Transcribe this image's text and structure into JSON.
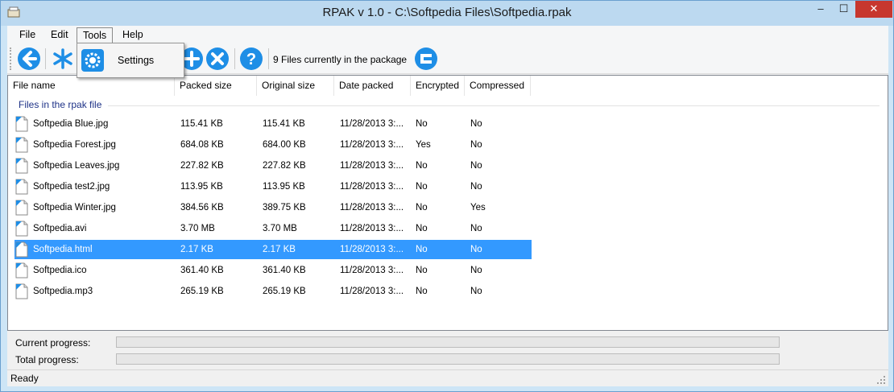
{
  "window": {
    "title": "RPAK v 1.0 - C:\\Softpedia Files\\Softpedia.rpak",
    "minimize_glyph": "‒",
    "maximize_glyph": "☐",
    "close_glyph": "✕"
  },
  "menu": {
    "items": [
      {
        "label": "File"
      },
      {
        "label": "Edit"
      },
      {
        "label": "Tools"
      },
      {
        "label": "Help"
      }
    ],
    "open_menu": "Tools",
    "dropdown": {
      "items": [
        {
          "label": "Settings",
          "icon": "gear-icon"
        }
      ]
    }
  },
  "toolbar": {
    "buttons": [
      {
        "name": "back-button",
        "icon": "arrow-left-icon"
      },
      {
        "name": "select-button",
        "icon": "asterisk-icon"
      },
      {
        "name": "settings-button",
        "icon": "gear-icon"
      },
      {
        "name": "add-button",
        "icon": "plus-icon"
      },
      {
        "name": "remove-button",
        "icon": "x-circle-icon"
      },
      {
        "name": "help-button",
        "icon": "question-icon"
      },
      {
        "name": "package-button",
        "icon": "package-icon"
      }
    ],
    "status": "9 Files currently in the package"
  },
  "list": {
    "columns": [
      "File name",
      "Packed size",
      "Original size",
      "Date packed",
      "Encrypted",
      "Compressed"
    ],
    "group_title": "Files in the rpak file",
    "rows": [
      {
        "name": "Softpedia Blue.jpg",
        "packed": "115.41 KB",
        "original": "115.41 KB",
        "date": "11/28/2013 3:...",
        "encrypted": "No",
        "compressed": "No"
      },
      {
        "name": "Softpedia Forest.jpg",
        "packed": "684.08 KB",
        "original": "684.00 KB",
        "date": "11/28/2013 3:...",
        "encrypted": "Yes",
        "compressed": "No"
      },
      {
        "name": "Softpedia Leaves.jpg",
        "packed": "227.82 KB",
        "original": "227.82 KB",
        "date": "11/28/2013 3:...",
        "encrypted": "No",
        "compressed": "No"
      },
      {
        "name": "Softpedia test2.jpg",
        "packed": "113.95 KB",
        "original": "113.95 KB",
        "date": "11/28/2013 3:...",
        "encrypted": "No",
        "compressed": "No"
      },
      {
        "name": "Softpedia Winter.jpg",
        "packed": "384.56 KB",
        "original": "389.75 KB",
        "date": "11/28/2013 3:...",
        "encrypted": "No",
        "compressed": "Yes"
      },
      {
        "name": "Softpedia.avi",
        "packed": "3.70 MB",
        "original": "3.70 MB",
        "date": "11/28/2013 3:...",
        "encrypted": "No",
        "compressed": "No"
      },
      {
        "name": "Softpedia.html",
        "packed": "2.17 KB",
        "original": "2.17 KB",
        "date": "11/28/2013 3:...",
        "encrypted": "No",
        "compressed": "No"
      },
      {
        "name": "Softpedia.ico",
        "packed": "361.40 KB",
        "original": "361.40 KB",
        "date": "11/28/2013 3:...",
        "encrypted": "No",
        "compressed": "No"
      },
      {
        "name": "Softpedia.mp3",
        "packed": "265.19 KB",
        "original": "265.19 KB",
        "date": "11/28/2013 3:...",
        "encrypted": "No",
        "compressed": "No"
      }
    ],
    "selected_row": "Softpedia.html"
  },
  "progress": {
    "current_label": "Current progress:",
    "current_value": 0,
    "total_label": "Total progress:",
    "total_value": 0
  },
  "status": {
    "text": "Ready"
  },
  "colors": {
    "selection": "#3399ff",
    "titlebar": "#bcd9f0",
    "close_button": "#c7372e",
    "icon_blue": "#1e8ee6"
  }
}
